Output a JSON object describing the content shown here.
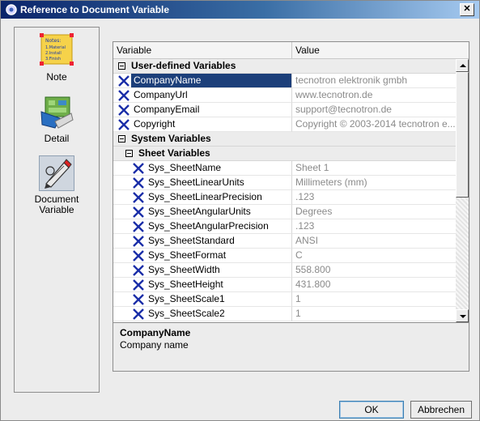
{
  "window": {
    "title": "Reference to Document Variable"
  },
  "sidebar": {
    "items": [
      {
        "label": "Note",
        "icon": "note-icon",
        "selected": false,
        "icon_text": [
          "Notes:",
          "1.Material",
          "2.Install",
          "3.Finish"
        ]
      },
      {
        "label": "Detail",
        "icon": "detail-icon",
        "selected": false
      },
      {
        "label": "Document\nVariable",
        "icon": "document-variable-icon",
        "selected": true
      }
    ]
  },
  "table": {
    "columns": [
      "Variable",
      "Value"
    ],
    "groups": {
      "user": "User-defined Variables",
      "system": "System Variables",
      "sheet": "Sheet Variables"
    },
    "user_rows": [
      {
        "name": "CompanyName",
        "value": "tecnotron elektronik gmbh",
        "selected": true
      },
      {
        "name": "CompanyUrl",
        "value": "www.tecnotron.de"
      },
      {
        "name": "CompanyEmail",
        "value": "support@tecnotron.de"
      },
      {
        "name": "Copyright",
        "value": "Copyright © 2003-2014 tecnotron e..."
      }
    ],
    "sheet_rows": [
      {
        "name": "Sys_SheetName",
        "value": "Sheet 1"
      },
      {
        "name": "Sys_SheetLinearUnits",
        "value": "Millimeters (mm)"
      },
      {
        "name": "Sys_SheetLinearPrecision",
        "value": ".123"
      },
      {
        "name": "Sys_SheetAngularUnits",
        "value": "Degrees"
      },
      {
        "name": "Sys_SheetAngularPrecision",
        "value": ".123"
      },
      {
        "name": "Sys_SheetStandard",
        "value": "ANSI"
      },
      {
        "name": "Sys_SheetFormat",
        "value": "C"
      },
      {
        "name": "Sys_SheetWidth",
        "value": "558.800"
      },
      {
        "name": "Sys_SheetHeight",
        "value": "431.800"
      },
      {
        "name": "Sys_SheetScale1",
        "value": "1"
      },
      {
        "name": "Sys_SheetScale2",
        "value": "1"
      }
    ]
  },
  "description": {
    "title": "CompanyName",
    "text": "Company name"
  },
  "buttons": {
    "ok": "OK",
    "cancel": "Abbrechen"
  },
  "colors": {
    "selection": "#1c3f7a",
    "x_icon": "#1a2ea8",
    "titlebar": "#0a246a"
  }
}
